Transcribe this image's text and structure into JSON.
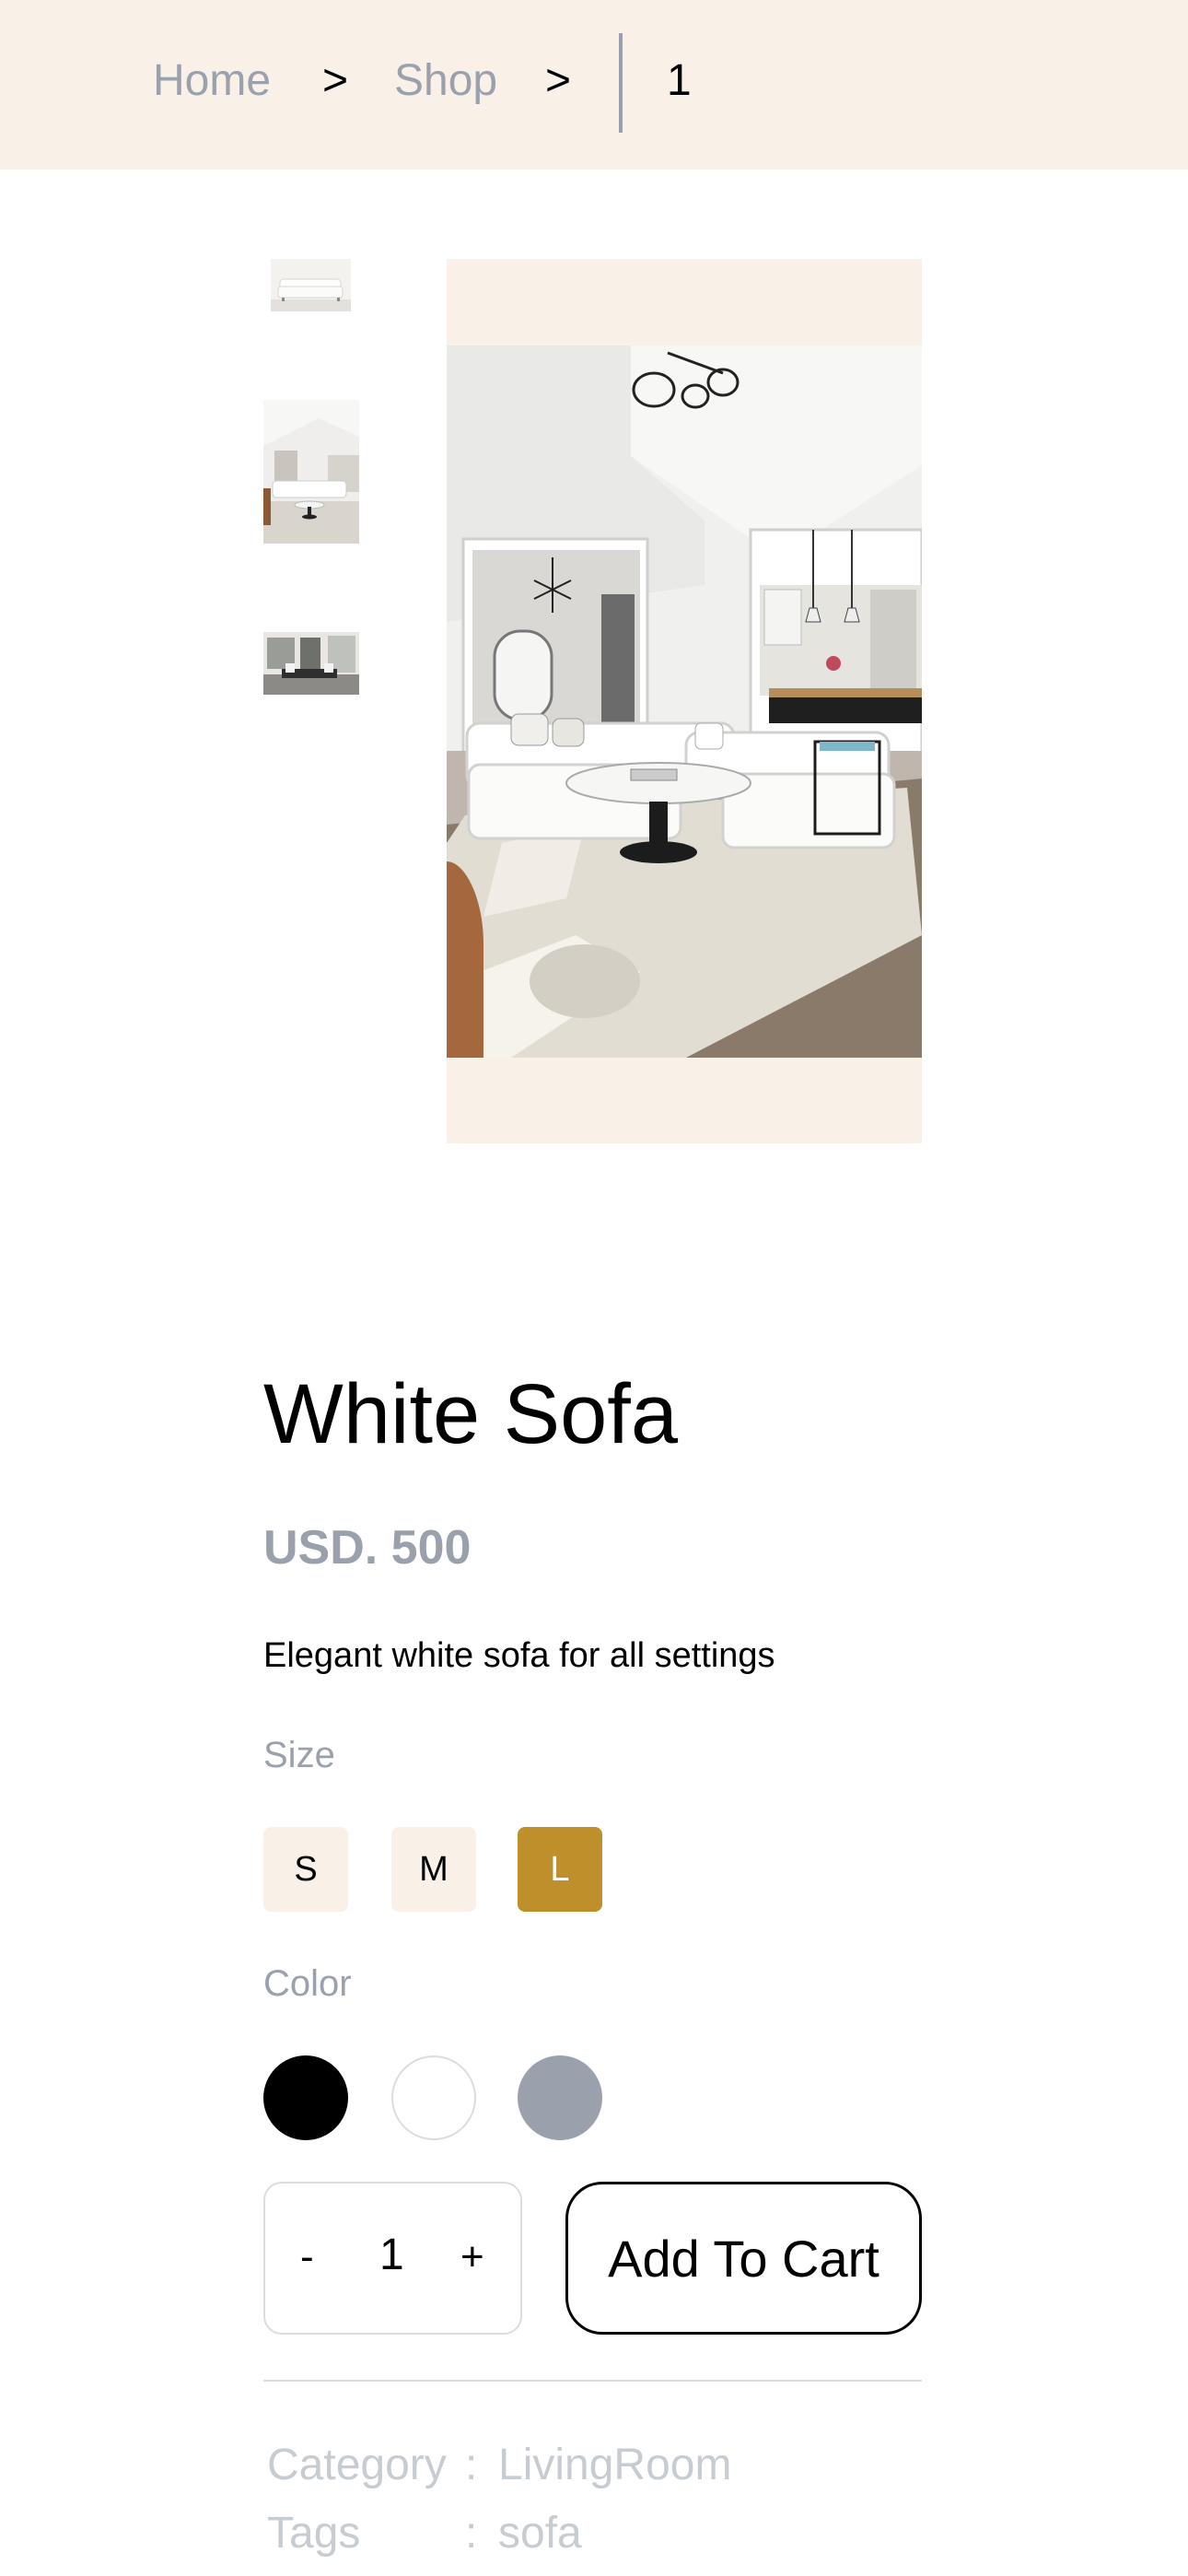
{
  "breadcrumb": {
    "home": "Home",
    "sep1": ">",
    "shop": "Shop",
    "sep2": ">",
    "current": "1"
  },
  "gallery": {
    "thumbnails": [
      "sofa-thumbnail",
      "living-room-thumbnail",
      "dining-room-thumbnail"
    ],
    "main_image": "living-room-photo"
  },
  "product": {
    "title": "White Sofa",
    "price": "USD. 500",
    "description": "Elegant white sofa for all settings"
  },
  "size": {
    "label": "Size",
    "options": [
      "S",
      "M",
      "L"
    ],
    "selected": "L"
  },
  "color": {
    "label": "Color",
    "options": [
      "#000000",
      "#ffffff",
      "#9aa1ad"
    ]
  },
  "quantity": {
    "minus": "-",
    "value": "1",
    "plus": "+"
  },
  "cart": {
    "label": "Add To Cart"
  },
  "meta": {
    "category_label": "Category",
    "category_sep": ":",
    "category_value": "LivingRoom",
    "tags_label": "Tags",
    "tags_sep": ":",
    "tags_value": "sofa"
  },
  "colors": {
    "cream": "#f9f1e7",
    "accent": "#bf8f2c",
    "muted": "#9aa1ad"
  }
}
